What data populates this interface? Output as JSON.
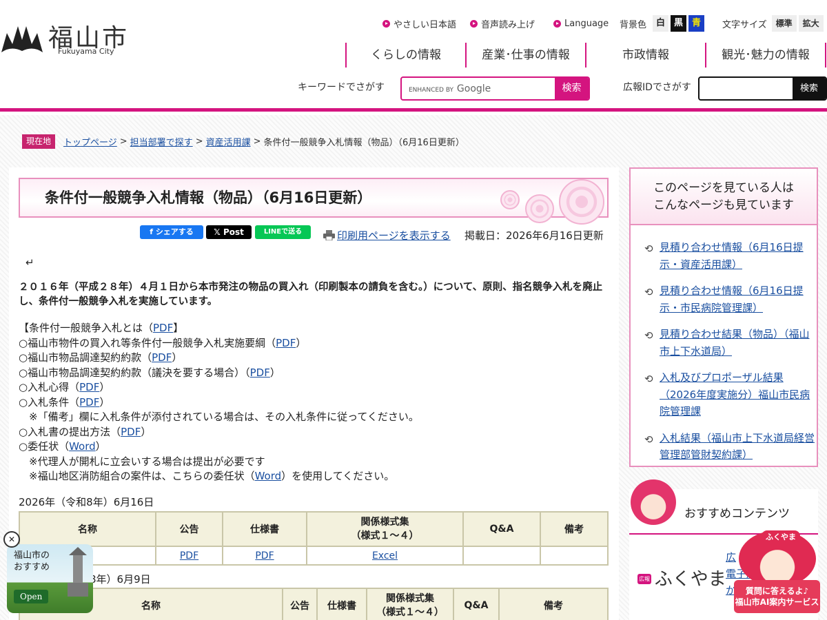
{
  "header": {
    "logo_name": "福山市",
    "logo_sub": "Fukuyama City",
    "util_links": [
      "やさしい日本語",
      "音声読み上げ",
      "Language"
    ],
    "bg_label": "背景色",
    "bg_options": [
      "白",
      "黒",
      "青"
    ],
    "size_label": "文字サイズ",
    "size_options": [
      "標準",
      "拡大"
    ],
    "nav": [
      "くらしの情報",
      "産業･仕事の情報",
      "市政情報",
      "観光･魅力の情報"
    ],
    "keyword_label": "キーワードでさがす",
    "google_enhanced": "ENHANCED BY",
    "google_brand": "Google",
    "search_button": "検索",
    "id_label": "広報IDでさがす",
    "id_button": "検索",
    "colors": {
      "accent": "#d4147f",
      "black_btn": "#111111",
      "blue_btn": "#1a3fc4",
      "yellow_text": "#f5e400"
    }
  },
  "breadcrumb": {
    "here": "現在地",
    "items": [
      "トップページ",
      "担当部署で探す",
      "資産活用課"
    ],
    "current": "条件付一般競争入札情報（物品）（6月16日更新）",
    "sep": ">"
  },
  "main": {
    "title": "条件付一般競争入札情報（物品）（6月16日更新）",
    "share": {
      "facebook": "シェアする",
      "x": "Post",
      "line": "LINEで送る"
    },
    "print_link": "印刷用ページを表示する",
    "posted": "掲載日：2026年6月16日更新",
    "return_mark": "↵",
    "intro": "２０１６年（平成２８年）４月１日から本市発注の物品の買入れ（印刷製本の請負を含む。）について、原則、指名競争入札を廃止し、条件付一般競争入札を実施しています。",
    "docs": [
      {
        "text": "【条件付一般競争入札とは（",
        "link": "PDF",
        "tail": "】"
      },
      {
        "text": "○福山市物件の買入れ等条件付一般競争入札実施要綱（",
        "link": "PDF",
        "tail": "）"
      },
      {
        "text": "○福山市物品調達契約約款（",
        "link": "PDF",
        "tail": "）"
      },
      {
        "text": "○福山市物品調達契約約款（議決を要する場合）（",
        "link": "PDF",
        "tail": "）"
      },
      {
        "text": "○入札心得（",
        "link": "PDF",
        "tail": "）"
      },
      {
        "text": "○入札条件（",
        "link": "PDF",
        "tail": "）"
      },
      {
        "text": "　※「備考」欄に入札条件が添付されている場合は、その入札条件に従ってください。",
        "link": "",
        "tail": ""
      },
      {
        "text": "○入札書の提出方法（",
        "link": "PDF",
        "tail": "）"
      },
      {
        "text": "○委任状（",
        "link": "Word",
        "tail": "）"
      },
      {
        "text": "　※代理人が開札に立会いする場合は提出が必要です",
        "link": "",
        "tail": ""
      },
      {
        "text": "　※福山地区消防組合の案件は、こちらの委任状（",
        "link": "Word",
        "tail": "）を使用してください。"
      }
    ],
    "section1": {
      "date": "2026年（令和8年）6月16日",
      "headers": [
        "名称",
        "公告",
        "仕様書",
        "関係様式集\n（様式１～４）",
        "Q&A",
        "備考"
      ],
      "row": [
        "",
        "PDF",
        "PDF",
        "Excel",
        "",
        ""
      ]
    },
    "section2": {
      "date_visible": "8年）6月9日",
      "headers": [
        "名称",
        "公告",
        "仕様書",
        "関係様式集\n（様式１～４）",
        "Q&A",
        "備考"
      ]
    }
  },
  "sidebar": {
    "title_line1": "このページを見ている人は",
    "title_line2": "こんなページも見ています",
    "links": [
      "見積り合わせ情報（6月16日提示・資産活用課）",
      "見積り合わせ情報（6月16日提示・市民病院管理課）",
      "見積り合わせ結果（物品）（福山市上下水道局）",
      "入札及びプロポーザル結果（2026年度実施分）福山市民病院管理課",
      "入札結果（福山市上下水道局経営管理部管財契約課）"
    ]
  },
  "reco": {
    "title": "おすすめコンテンツ",
    "badge": "広報",
    "brand": "ふくやま",
    "links_visible": [
      "広",
      "電子版",
      "から"
    ]
  },
  "popup": {
    "title_line1": "福山市の",
    "title_line2": "おすすめ",
    "open": "Open",
    "close": "✕"
  },
  "ai": {
    "line1": "質問に答えるよ♪",
    "line2": "福山市AI案内サービス",
    "tag": "ふくやま"
  }
}
